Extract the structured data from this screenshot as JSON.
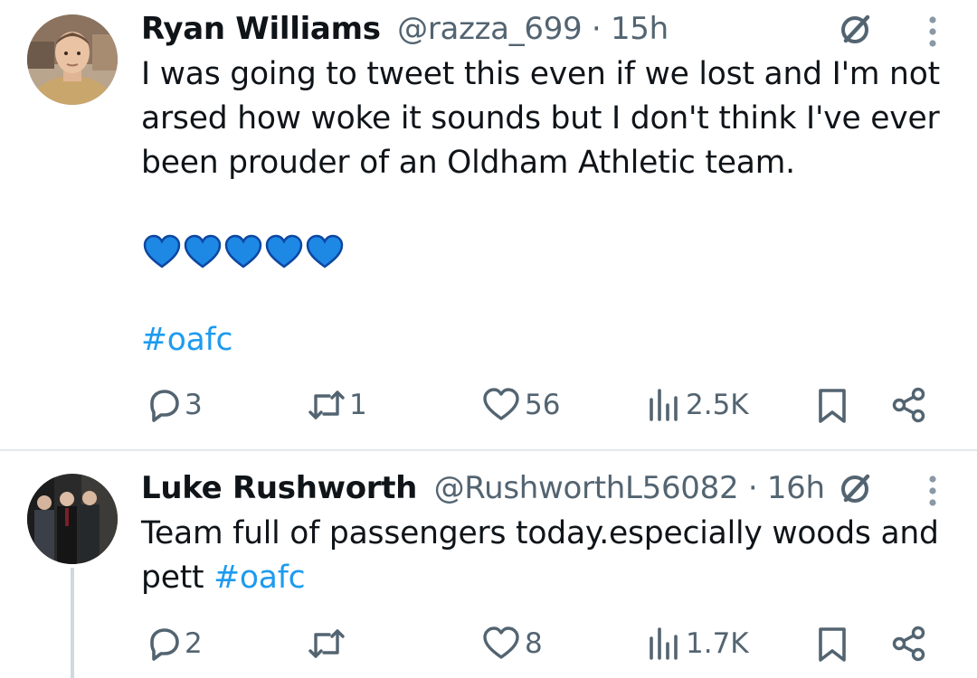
{
  "tweets": [
    {
      "author_name": "Ryan Williams",
      "handle": "@razza_699",
      "separator": "·",
      "time": "15h",
      "text_lines": [
        "I was going to tweet this even if we lost and I'm not",
        "arsed how woke it sounds but I don't think I've ever",
        "been prouder of an Oldham Athletic team."
      ],
      "emoji": "💙💙💙💙💙",
      "hashtag": "#oafc",
      "stats": {
        "replies": "3",
        "retweets": "1",
        "likes": "56",
        "views": "2.5K"
      }
    },
    {
      "author_name": "Luke Rushworth",
      "handle": "@RushworthL56082",
      "separator": "·",
      "time": "16h",
      "text_lines": [
        "Team full of passengers today.especially woods and",
        "pett"
      ],
      "hashtag": "#oafc",
      "stats": {
        "replies": "2",
        "retweets": "",
        "likes": "8",
        "views": "1.7K"
      }
    }
  ],
  "colors": {
    "text": "#0f1419",
    "secondary": "#536471",
    "accent_link": "#1d9bf0",
    "emoji_heart": "#1e88e5",
    "divider": "#e6e9ec"
  },
  "icons": [
    "avatar",
    "grok-icon",
    "more-vertical-icon",
    "reply-icon",
    "retweet-icon",
    "heart-icon",
    "views-icon",
    "bookmark-icon",
    "share-icon",
    "blue-heart-emoji"
  ]
}
